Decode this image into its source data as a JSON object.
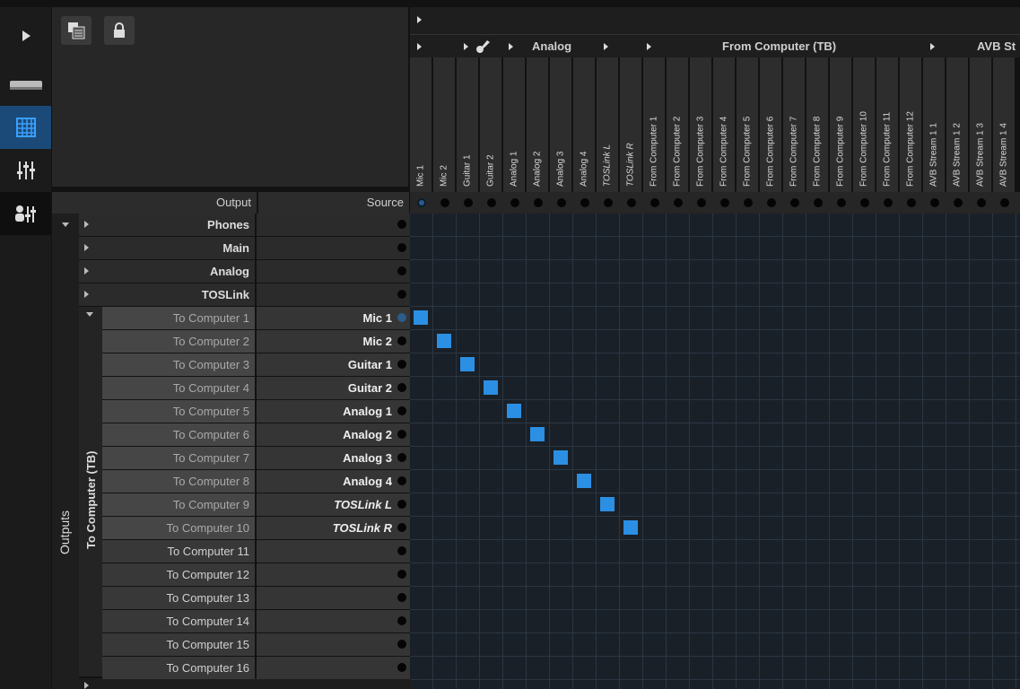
{
  "header": {
    "output_label": "Output",
    "source_label": "Source"
  },
  "groups": [
    {
      "label": "Analog"
    },
    {
      "label": "From Computer (TB)"
    },
    {
      "label": "AVB St"
    }
  ],
  "source_columns": [
    "Mic 1",
    "Mic 2",
    "Guitar 1",
    "Guitar 2",
    "Analog 1",
    "Analog 2",
    "Analog 3",
    "Analog 4",
    "TOSLink L",
    "TOSLink R",
    "From Computer 1",
    "From Computer 2",
    "From Computer 3",
    "From Computer 4",
    "From Computer 5",
    "From Computer 6",
    "From Computer 7",
    "From Computer 8",
    "From Computer 9",
    "From Computer 10",
    "From Computer 11",
    "From Computer 12",
    "AVB Stream 1 1",
    "AVB Stream 1 2",
    "AVB Stream 1 3",
    "AVB Stream 1 4"
  ],
  "output_groups": [
    "Phones",
    "Main",
    "Analog",
    "TOSLink"
  ],
  "sidebar": {
    "outputs_label": "Outputs",
    "subgroup_label": "To Computer (TB)"
  },
  "rows": [
    {
      "output": "To Computer 1",
      "source": "Mic 1"
    },
    {
      "output": "To Computer 2",
      "source": "Mic 2"
    },
    {
      "output": "To Computer 3",
      "source": "Guitar 1"
    },
    {
      "output": "To Computer 4",
      "source": "Guitar 2"
    },
    {
      "output": "To Computer 5",
      "source": "Analog 1"
    },
    {
      "output": "To Computer 6",
      "source": "Analog 2"
    },
    {
      "output": "To Computer 7",
      "source": "Analog 3"
    },
    {
      "output": "To Computer 8",
      "source": "Analog 4"
    },
    {
      "output": "To Computer 9",
      "source": "TOSLink L"
    },
    {
      "output": "To Computer 10",
      "source": "TOSLink R"
    },
    {
      "output": "To Computer 11",
      "source": ""
    },
    {
      "output": "To Computer 12",
      "source": ""
    },
    {
      "output": "To Computer 13",
      "source": ""
    },
    {
      "output": "To Computer 14",
      "source": ""
    },
    {
      "output": "To Computer 15",
      "source": ""
    },
    {
      "output": "To Computer 16",
      "source": ""
    }
  ],
  "routes": [
    [
      0,
      0
    ],
    [
      1,
      1
    ],
    [
      2,
      2
    ],
    [
      3,
      3
    ],
    [
      4,
      4
    ],
    [
      5,
      5
    ],
    [
      6,
      6
    ],
    [
      7,
      7
    ],
    [
      8,
      8
    ],
    [
      9,
      9
    ]
  ],
  "colors": {
    "accent": "#2b8fe3",
    "active_tab": "#1c4a78"
  },
  "icons": [
    "play-arrow-icon",
    "device-icon",
    "grid-icon",
    "mixer-icon",
    "user-mixer-icon",
    "routing-list-icon",
    "lock-icon"
  ]
}
